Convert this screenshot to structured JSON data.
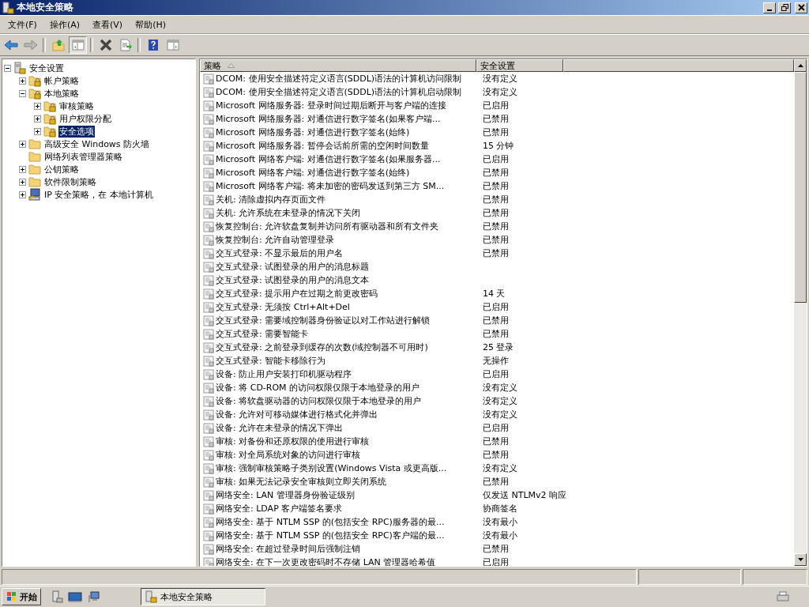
{
  "window": {
    "title": "本地安全策略"
  },
  "menu": [
    "文件(F)",
    "操作(A)",
    "查看(V)",
    "帮助(H)"
  ],
  "tree": [
    {
      "label": "安全设置",
      "kind": "root",
      "selected": false,
      "expanded": true,
      "children": [
        {
          "label": "帐户策略",
          "kind": "policy",
          "selected": false,
          "expanded": false
        },
        {
          "label": "本地策略",
          "kind": "policy",
          "selected": false,
          "expanded": true,
          "children": [
            {
              "label": "审核策略",
              "kind": "policy",
              "selected": false,
              "expanded": false
            },
            {
              "label": "用户权限分配",
              "kind": "policy",
              "selected": false,
              "expanded": false
            },
            {
              "label": "安全选项",
              "kind": "policy",
              "selected": true,
              "expanded": false
            }
          ]
        },
        {
          "label": "高级安全 Windows 防火墙",
          "kind": "folder",
          "selected": false,
          "expanded": false
        },
        {
          "label": "网络列表管理器策略",
          "kind": "folder",
          "selected": false
        },
        {
          "label": "公钥策略",
          "kind": "folder",
          "selected": false,
          "expanded": false
        },
        {
          "label": "软件限制策略",
          "kind": "folder",
          "selected": false,
          "expanded": false
        },
        {
          "label": "IP 安全策略，在 本地计算机",
          "kind": "computer",
          "selected": false,
          "expanded": false
        }
      ]
    }
  ],
  "table": {
    "columns": [
      "策略",
      "安全设置"
    ],
    "rows": [
      {
        "policy": "DCOM: 使用安全描述符定义语言(SDDL)语法的计算机访问限制",
        "setting": "没有定义"
      },
      {
        "policy": "DCOM: 使用安全描述符定义语言(SDDL)语法的计算机启动限制",
        "setting": "没有定义"
      },
      {
        "policy": "Microsoft 网络服务器: 登录时间过期后断开与客户端的连接",
        "setting": "已启用"
      },
      {
        "policy": "Microsoft 网络服务器: 对通信进行数字签名(如果客户端...",
        "setting": "已禁用"
      },
      {
        "policy": "Microsoft 网络服务器: 对通信进行数字签名(始终)",
        "setting": "已禁用"
      },
      {
        "policy": "Microsoft 网络服务器: 暂停会话前所需的空闲时间数量",
        "setting": "15 分钟"
      },
      {
        "policy": "Microsoft 网络客户端: 对通信进行数字签名(如果服务器...",
        "setting": "已启用"
      },
      {
        "policy": "Microsoft 网络客户端: 对通信进行数字签名(始终)",
        "setting": "已禁用"
      },
      {
        "policy": "Microsoft 网络客户端: 将未加密的密码发送到第三方 SM...",
        "setting": "已禁用"
      },
      {
        "policy": "关机: 清除虚拟内存页面文件",
        "setting": "已禁用"
      },
      {
        "policy": "关机: 允许系统在未登录的情况下关闭",
        "setting": "已禁用"
      },
      {
        "policy": "恢复控制台: 允许软盘复制并访问所有驱动器和所有文件夹",
        "setting": "已禁用"
      },
      {
        "policy": "恢复控制台: 允许自动管理登录",
        "setting": "已禁用"
      },
      {
        "policy": "交互式登录: 不显示最后的用户名",
        "setting": "已禁用"
      },
      {
        "policy": "交互式登录: 试图登录的用户的消息标题"
      },
      {
        "policy": "交互式登录: 试图登录的用户的消息文本"
      },
      {
        "policy": "交互式登录: 提示用户在过期之前更改密码",
        "setting": "14 天"
      },
      {
        "policy": "交互式登录: 无须按 Ctrl+Alt+Del",
        "setting": "已启用"
      },
      {
        "policy": "交互式登录: 需要域控制器身份验证以对工作站进行解锁",
        "setting": "已禁用"
      },
      {
        "policy": "交互式登录: 需要智能卡",
        "setting": "已禁用"
      },
      {
        "policy": "交互式登录: 之前登录到缓存的次数(域控制器不可用时)",
        "setting": "25 登录"
      },
      {
        "policy": "交互式登录: 智能卡移除行为",
        "setting": "无操作"
      },
      {
        "policy": "设备: 防止用户安装打印机驱动程序",
        "setting": "已启用"
      },
      {
        "policy": "设备: 将 CD-ROM 的访问权限仅限于本地登录的用户",
        "setting": "没有定义"
      },
      {
        "policy": "设备: 将软盘驱动器的访问权限仅限于本地登录的用户",
        "setting": "没有定义"
      },
      {
        "policy": "设备: 允许对可移动媒体进行格式化并弹出",
        "setting": "没有定义"
      },
      {
        "policy": "设备: 允许在未登录的情况下弹出",
        "setting": "已启用"
      },
      {
        "policy": "审核: 对备份和还原权限的使用进行审核",
        "setting": "已禁用"
      },
      {
        "policy": "审核: 对全局系统对象的访问进行审核",
        "setting": "已禁用"
      },
      {
        "policy": "审核: 强制审核策略子类别设置(Windows Vista 或更高版...",
        "setting": "没有定义"
      },
      {
        "policy": "审核: 如果无法记录安全审核则立即关闭系统",
        "setting": "已禁用"
      },
      {
        "policy": "网络安全: LAN 管理器身份验证级别",
        "setting": "仅发送 NTLMv2 响应"
      },
      {
        "policy": "网络安全: LDAP 客户端签名要求",
        "setting": "协商签名"
      },
      {
        "policy": "网络安全: 基于 NTLM SSP 的(包括安全 RPC)服务器的最...",
        "setting": "没有最小"
      },
      {
        "policy": "网络安全: 基于 NTLM SSP 的(包括安全 RPC)客户端的最...",
        "setting": "没有最小"
      },
      {
        "policy": "网络安全: 在超过登录时间后强制注销",
        "setting": "已禁用"
      },
      {
        "policy": "网络安全: 在下一次更改密码时不存储 LAN 管理器哈希值",
        "setting": "已启用"
      }
    ]
  },
  "taskbar": {
    "start": "开始",
    "tasks": [
      {
        "label": "本地安全策略",
        "selected": true
      }
    ]
  }
}
